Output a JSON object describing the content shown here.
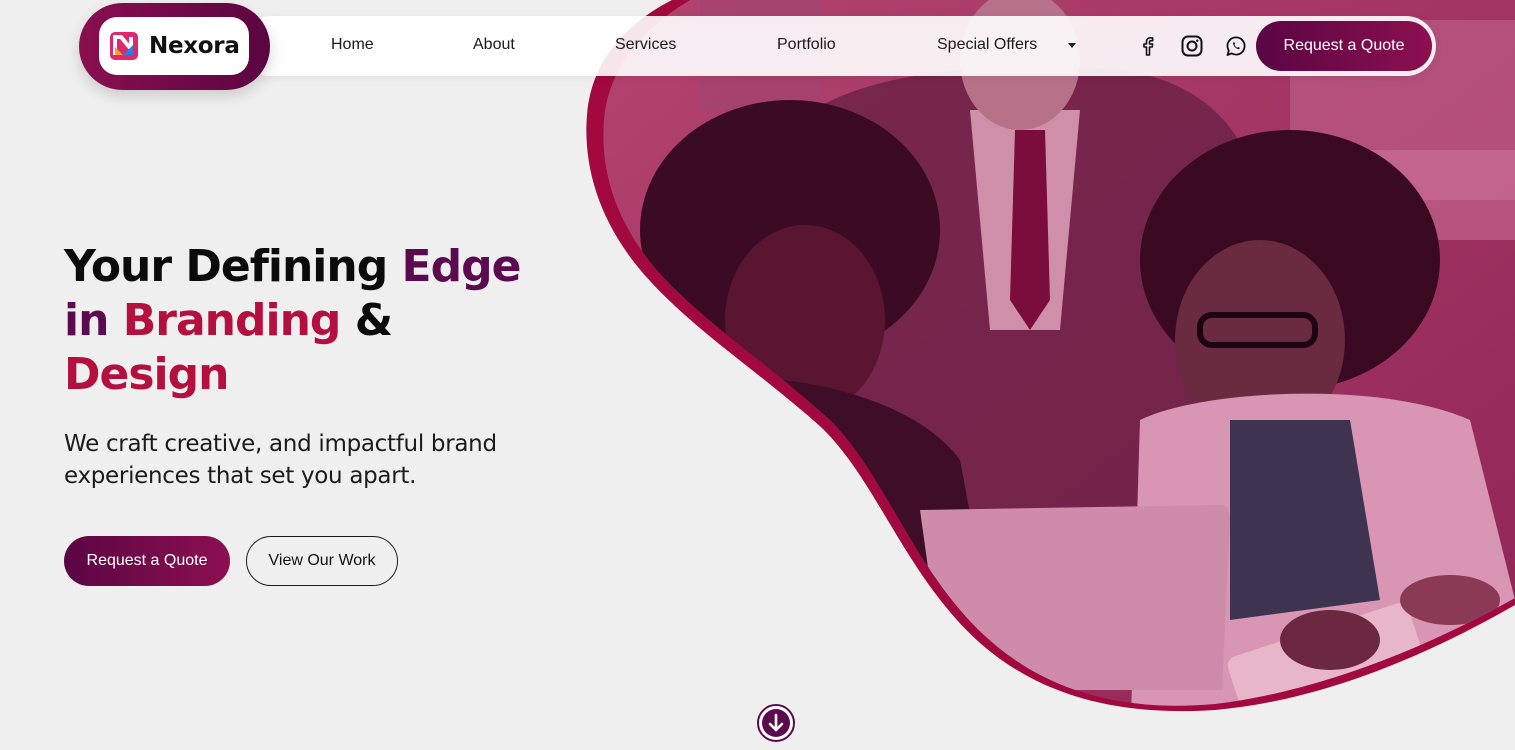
{
  "brand": {
    "name": "Nexora",
    "logo_icon": "nexora-logo-mark"
  },
  "nav": {
    "items": [
      {
        "label": "Home"
      },
      {
        "label": "About"
      },
      {
        "label": "Services"
      },
      {
        "label": "Portfolio"
      },
      {
        "label": "Special Offers",
        "has_dropdown": true
      }
    ],
    "social": [
      {
        "icon": "facebook-icon"
      },
      {
        "icon": "instagram-icon"
      },
      {
        "icon": "whatsapp-icon"
      }
    ],
    "cta_label": "Request a Quote"
  },
  "hero": {
    "headline": {
      "w1": "Your Defining ",
      "w2": "Edge",
      "w3": "in ",
      "w4": "Branding",
      "w5": " & ",
      "w6": "Design"
    },
    "subtitle": "We craft creative, and impactful brand experiences that set you apart.",
    "primary_button": "Request a Quote",
    "secondary_button": "View Our Work",
    "image_alt": "team-meeting-photo",
    "scroll_icon": "arrow-down-circle-icon"
  },
  "colors": {
    "plum": "#5c0a4f",
    "crimson": "#b3103f",
    "accent_gradient": [
      "#5b0544",
      "#8c1050"
    ],
    "page_bg": "#efefef"
  }
}
